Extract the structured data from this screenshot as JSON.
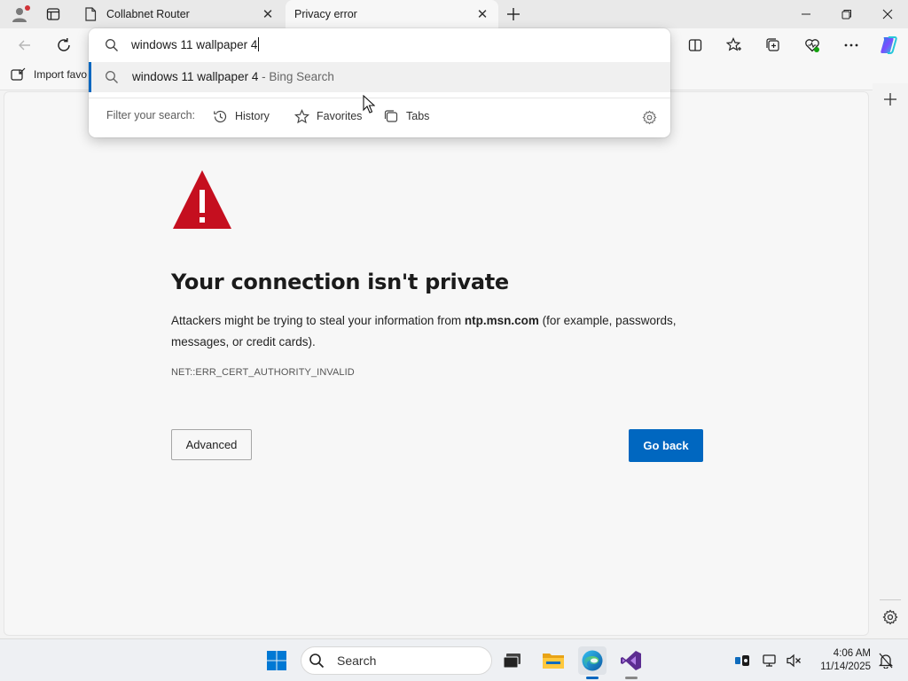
{
  "tabs": [
    {
      "title": "Collabnet Router",
      "active": false
    },
    {
      "title": "Privacy error",
      "active": true
    }
  ],
  "favorites_bar": {
    "import_label": "Import favo"
  },
  "omnibox": {
    "query": "windows 11 wallpaper 4",
    "suggestion": {
      "query": "windows 11 wallpaper 4",
      "suffix": " - Bing Search"
    },
    "filter_label": "Filter your search:",
    "filters": [
      "History",
      "Favorites",
      "Tabs"
    ]
  },
  "error_page": {
    "title": "Your connection isn't private",
    "desc_before": "Attackers might be trying to steal your information from ",
    "host": "ntp.msn.com",
    "desc_after": " (for example, passwords, messages, or credit cards).",
    "code": "NET::ERR_CERT_AUTHORITY_INVALID",
    "advanced_label": "Advanced",
    "back_label": "Go back"
  },
  "taskbar": {
    "search_label": "Search",
    "time": "4:06 AM",
    "date": "11/14/2025"
  },
  "colors": {
    "accent": "#0067c0",
    "warning": "#c50f1f"
  },
  "icons": [
    "profile-icon",
    "tab-actions-icon",
    "page-icon",
    "close-icon",
    "plus-icon",
    "minimize-icon",
    "restore-icon",
    "back-icon",
    "refresh-icon",
    "split-screen-icon",
    "favorites-icon",
    "collections-icon",
    "browser-essentials-icon",
    "more-icon",
    "copilot-icon",
    "import-icon",
    "search-icon",
    "history-icon",
    "star-icon",
    "tabs-icon",
    "gear-icon",
    "warning-icon",
    "windows-start-icon",
    "task-view-icon",
    "file-explorer-icon",
    "edge-icon",
    "visual-studio-icon"
  ]
}
